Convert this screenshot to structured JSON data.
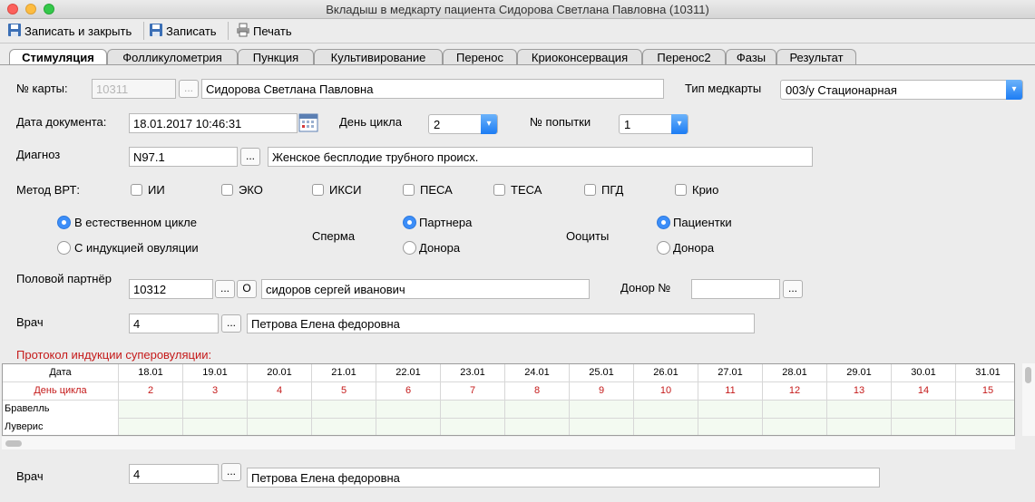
{
  "window": {
    "title": "Вкладыш в медкарту пациента Сидорова Светлана Павловна (10311)"
  },
  "toolbar": {
    "save_close": "Записать и закрыть",
    "save": "Записать",
    "print": "Печать"
  },
  "tabs": [
    "Стимуляция",
    "Фолликулометрия",
    "Пункция",
    "Культивирование",
    "Перенос",
    "Криоконсервация",
    "Перенос2",
    "Фазы",
    "Результат"
  ],
  "card": {
    "label": "№ карты:",
    "number": "10311",
    "patient_name": "Сидорова Светлана Павловна",
    "type_label": "Тип медкарты",
    "type_value": "003/у Стационарная"
  },
  "doc": {
    "date_label": "Дата документа:",
    "date_value": "18.01.2017 10:46:31",
    "cycle_day_label": "День цикла",
    "cycle_day_value": "2",
    "attempt_label": "№ попытки",
    "attempt_value": "1"
  },
  "diagnosis": {
    "label": "Диагноз",
    "code": "N97.1",
    "text": "Женское бесплодие трубного происх."
  },
  "vrt": {
    "label": "Метод ВРТ:",
    "options": [
      "ИИ",
      "ЭКО",
      "ИКСИ",
      "ПЕСА",
      "ТЕСА",
      "ПГД",
      "Крио"
    ]
  },
  "cycle": {
    "natural": "В естественном цикле",
    "induced": "С индукцией овуляции"
  },
  "sperm": {
    "label": "Сперма",
    "partner": "Партнера",
    "donor": "Донора"
  },
  "oocytes": {
    "label": "Ооциты",
    "patient": "Пациентки",
    "donor": "Донора"
  },
  "partner": {
    "label": "Половой партнёр",
    "id": "10312",
    "o_button": "О",
    "name": "сидоров сергей иванович",
    "donor_label": "Донор №",
    "donor_value": ""
  },
  "doctor": {
    "label": "Врач",
    "id": "4",
    "name": "Петрова Елена федоровна"
  },
  "protocol": {
    "title": "Протокол индукции суперовуляции:",
    "row_headers": [
      "Дата",
      "День цикла",
      "Бравелль",
      "Луверис"
    ],
    "dates": [
      "18.01",
      "19.01",
      "20.01",
      "21.01",
      "22.01",
      "23.01",
      "24.01",
      "25.01",
      "26.01",
      "27.01",
      "28.01",
      "29.01",
      "30.01",
      "31.01"
    ],
    "cycle_days": [
      "2",
      "3",
      "4",
      "5",
      "6",
      "7",
      "8",
      "9",
      "10",
      "11",
      "12",
      "13",
      "14",
      "15"
    ]
  },
  "doctor2": {
    "label": "Врач",
    "id": "4",
    "name": "Петрова Елена федоровна"
  },
  "ellipsis": "...",
  "colors": {
    "accent": "#3c8ef8",
    "red_text": "#c51a1a"
  }
}
